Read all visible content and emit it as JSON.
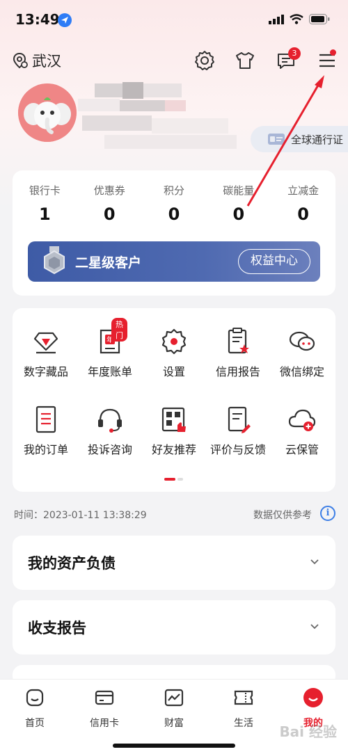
{
  "status_bar": {
    "time": "13:49"
  },
  "header": {
    "city": "武汉",
    "message_count": "3"
  },
  "profile": {
    "passport_label": "全球通行证"
  },
  "stats": [
    {
      "label": "银行卡",
      "value": "1"
    },
    {
      "label": "优惠券",
      "value": "0"
    },
    {
      "label": "积分",
      "value": "0"
    },
    {
      "label": "碳能量",
      "value": "0"
    },
    {
      "label": "立减金",
      "value": "0"
    }
  ],
  "membership": {
    "level": "二星级客户",
    "button": "权益中心"
  },
  "grid": {
    "hot_tag": "热门",
    "items": [
      {
        "label": "数字藏品",
        "icon": "diamond-icon"
      },
      {
        "label": "年度账单",
        "icon": "calendar-icon"
      },
      {
        "label": "设置",
        "icon": "gear-icon"
      },
      {
        "label": "信用报告",
        "icon": "report-icon"
      },
      {
        "label": "微信绑定",
        "icon": "chat-icon"
      },
      {
        "label": "我的订单",
        "icon": "order-icon"
      },
      {
        "label": "投诉咨询",
        "icon": "headset-icon"
      },
      {
        "label": "好友推荐",
        "icon": "qrcode-icon"
      },
      {
        "label": "评价与反馈",
        "icon": "feedback-icon"
      },
      {
        "label": "云保管",
        "icon": "cloud-icon"
      }
    ]
  },
  "info": {
    "time": "时间：2023-01-11 13:38:29",
    "reference": "数据仅供参考"
  },
  "sections": [
    {
      "title": "我的资产负债"
    },
    {
      "title": "收支报告"
    }
  ],
  "nav": [
    {
      "label": "首页"
    },
    {
      "label": "信用卡"
    },
    {
      "label": "财富"
    },
    {
      "label": "生活"
    },
    {
      "label": "我的"
    }
  ],
  "colors": {
    "accent": "#e6202e",
    "member_bar": "#3e5ba6",
    "info": "#3c7ee6"
  },
  "watermark": "Bai 经验"
}
